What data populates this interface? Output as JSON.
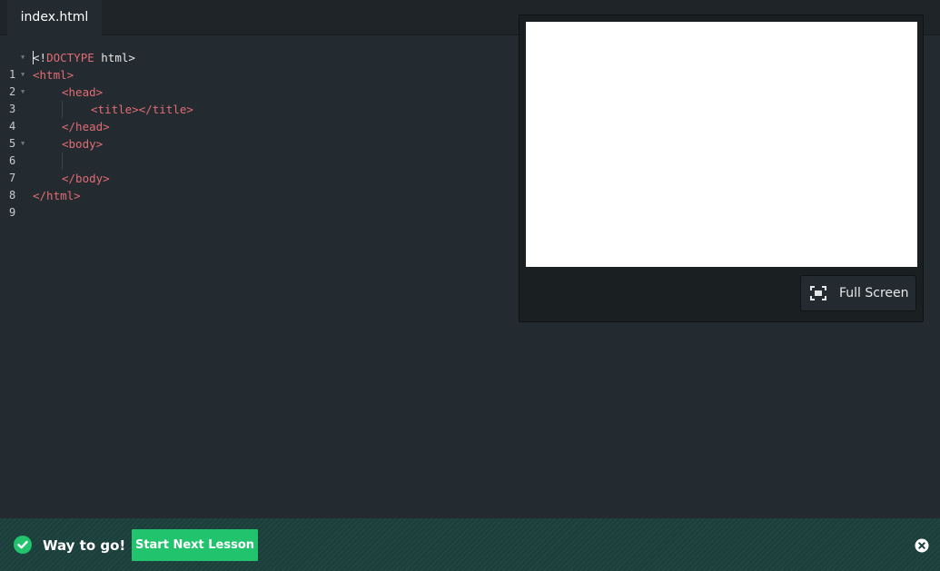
{
  "tabs": [
    {
      "label": "index.html",
      "active": true
    }
  ],
  "editor": {
    "lines": [
      {
        "number": "1",
        "fold": true
      },
      {
        "number": "2",
        "fold": true
      },
      {
        "number": "3",
        "fold": true
      },
      {
        "number": "4",
        "fold": false
      },
      {
        "number": "5",
        "fold": false
      },
      {
        "number": "6",
        "fold": true
      },
      {
        "number": "7",
        "fold": false
      },
      {
        "number": "8",
        "fold": false
      },
      {
        "number": "9",
        "fold": false
      }
    ],
    "code": {
      "l1_open": "<!",
      "l1_doctype": "DOCTYPE",
      "l1_html": " html>",
      "l2": "<html>",
      "l3": "<head>",
      "l4": "<title></title>",
      "l5": "</head>",
      "l6": "<body>",
      "l8": "</body>",
      "l9": "</html>"
    }
  },
  "preview": {
    "fullscreen_label": "Full Screen"
  },
  "success": {
    "message": "Way to go!",
    "next_label": "Start Next Lesson"
  },
  "colors": {
    "editor_bg": "#242b30",
    "tag": "#e06c75",
    "accent_green": "#21c46c",
    "success_bar": "#1b3f3b"
  }
}
